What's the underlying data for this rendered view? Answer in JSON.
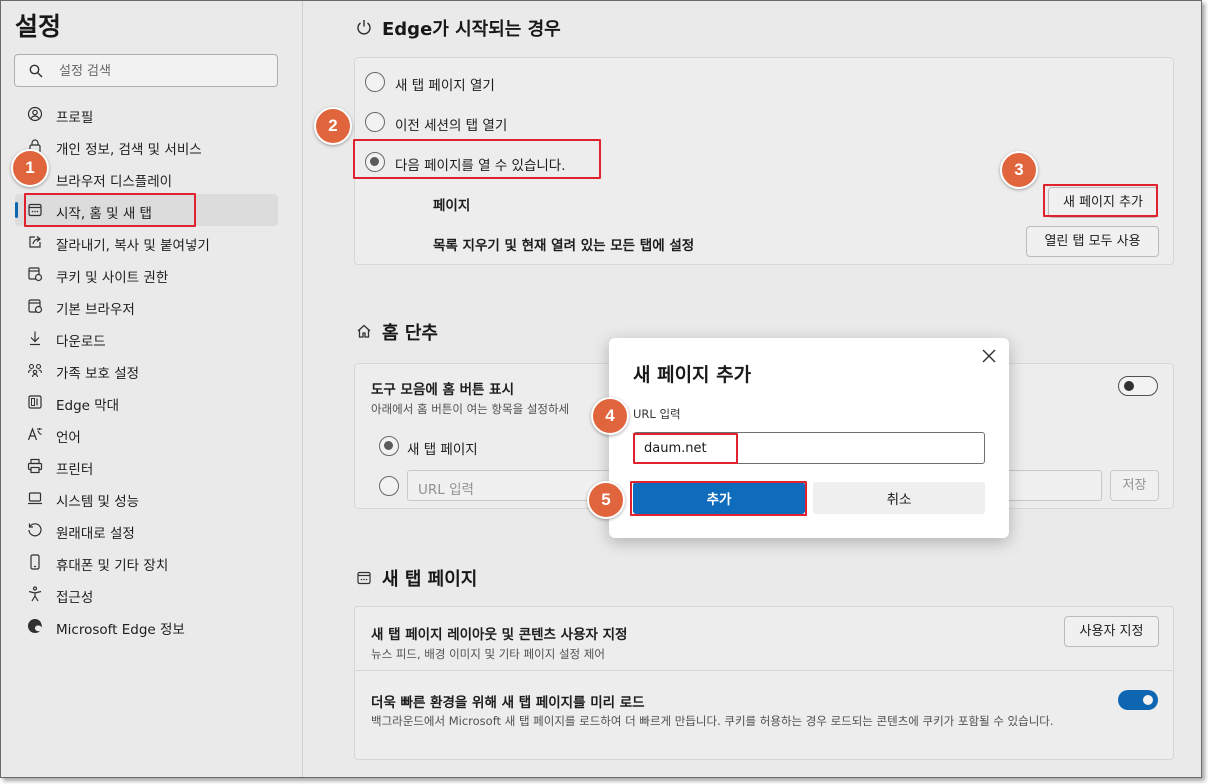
{
  "sidebar": {
    "title": "설정",
    "search_placeholder": "설정 검색",
    "items": [
      {
        "label": "프로필",
        "icon": "profile-icon"
      },
      {
        "label": "개인 정보, 검색 및 서비스",
        "icon": "lock-icon"
      },
      {
        "label": "브라우저 디스플레이",
        "icon": "display-icon"
      },
      {
        "label": "시작, 홈 및 새 탭",
        "icon": "home-tab-icon",
        "active": true
      },
      {
        "label": "잘라내기, 복사 및 붙여넣기",
        "icon": "share-icon"
      },
      {
        "label": "쿠키 및 사이트 권한",
        "icon": "cookie-icon"
      },
      {
        "label": "기본 브라우저",
        "icon": "browser-icon"
      },
      {
        "label": "다운로드",
        "icon": "download-icon"
      },
      {
        "label": "가족 보호 설정",
        "icon": "family-icon"
      },
      {
        "label": "Edge 막대",
        "icon": "edge-bar-icon"
      },
      {
        "label": "언어",
        "icon": "language-icon"
      },
      {
        "label": "프린터",
        "icon": "printer-icon"
      },
      {
        "label": "시스템 및 성능",
        "icon": "system-icon"
      },
      {
        "label": "원래대로 설정",
        "icon": "reset-icon"
      },
      {
        "label": "휴대폰 및 기타 장치",
        "icon": "phone-icon"
      },
      {
        "label": "접근성",
        "icon": "accessibility-icon"
      },
      {
        "label": "Microsoft Edge 정보",
        "icon": "edge-logo-icon"
      }
    ]
  },
  "startup": {
    "title": "Edge가 시작되는 경우",
    "options": [
      {
        "label": "새 탭 페이지 열기",
        "selected": false
      },
      {
        "label": "이전 세션의 탭 열기",
        "selected": false
      },
      {
        "label": "다음 페이지를 열 수 있습니다.",
        "selected": true
      }
    ],
    "pages_label": "페이지",
    "add_page_button": "새 페이지 추가",
    "clear_label": "목록 지우기 및 현재 열려 있는 모든 탭에 설정",
    "use_open_tabs_button": "열린 탭 모두 사용"
  },
  "home": {
    "title": "홈 단추",
    "toolbar_label": "도구 모음에 홈 버튼 표시",
    "toolbar_desc": "아래에서 홈 버튼이 여는 항목을 설정하세",
    "toolbar_toggle": false,
    "new_tab_option": "새 탭 페이지",
    "url_placeholder": "URL 입력",
    "save_button": "저장"
  },
  "newtab": {
    "title": "새 탭 페이지",
    "layout_label": "새 탭 페이지 레이아웃 및 콘텐츠 사용자 지정",
    "layout_desc": "뉴스 피드, 배경 이미지 및 기타 페이지 설정 제어",
    "customize_button": "사용자 지정",
    "preload_label": "더욱 빠른 환경을 위해 새 탭 페이지를 미리 로드",
    "preload_desc": "백그라운드에서 Microsoft 새 탭 페이지를 로드하여 더 빠르게 만듭니다. 쿠키를 허용하는 경우 로드되는 콘텐츠에 쿠키가 포함될 수 있습니다.",
    "preload_toggle": true
  },
  "dialog": {
    "title": "새 페이지 추가",
    "url_label": "URL 입력",
    "url_value": "daum.net",
    "add_button": "추가",
    "cancel_button": "취소"
  },
  "steps": [
    "1",
    "2",
    "3",
    "4",
    "5"
  ],
  "colors": {
    "accent": "#0f6cbd",
    "highlight": "#e0212e",
    "step_badge": "#e0653c"
  }
}
